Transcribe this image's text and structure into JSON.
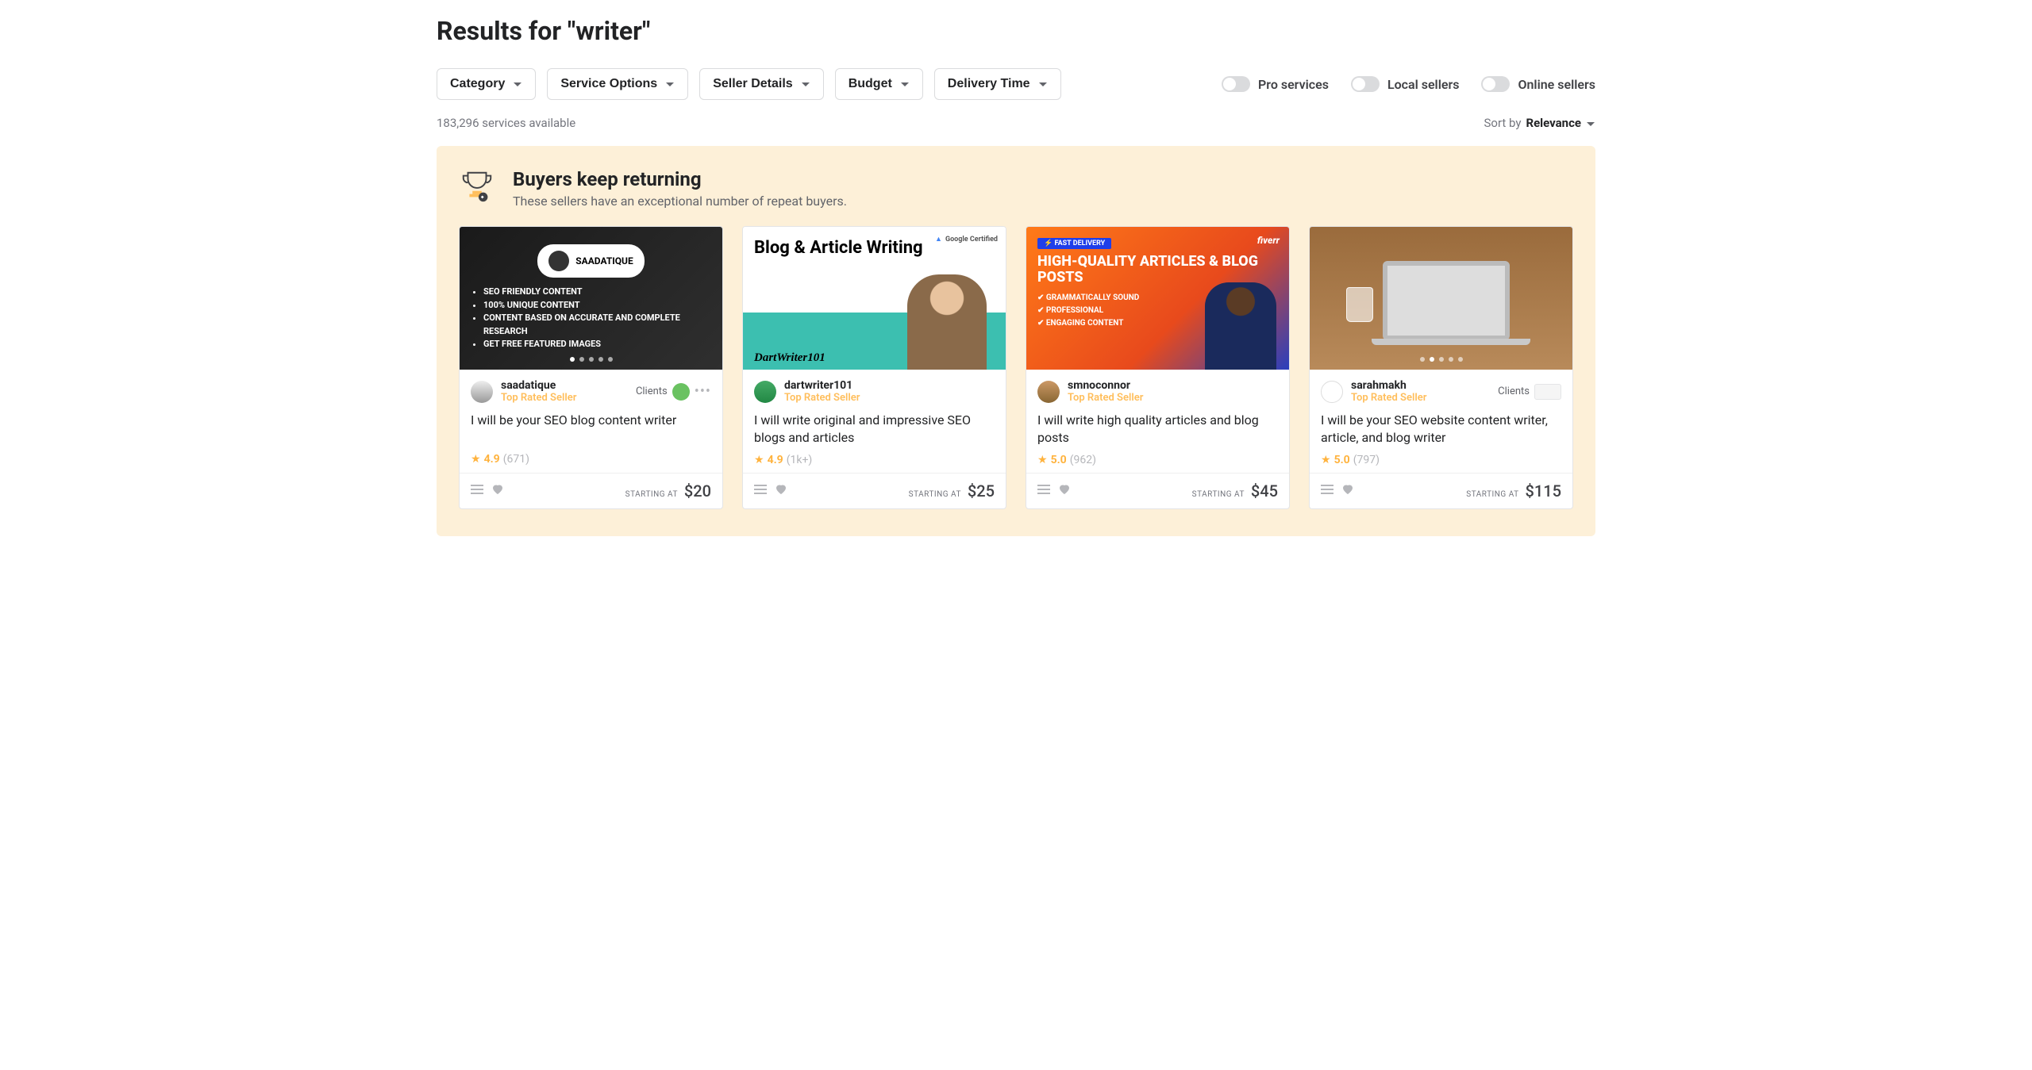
{
  "page_title": "Results for \"writer\"",
  "filters": [
    {
      "label": "Category"
    },
    {
      "label": "Service Options"
    },
    {
      "label": "Seller Details"
    },
    {
      "label": "Budget"
    },
    {
      "label": "Delivery Time"
    }
  ],
  "toggles": [
    {
      "label": "Pro services"
    },
    {
      "label": "Local sellers"
    },
    {
      "label": "Online sellers"
    }
  ],
  "results_count": "183,296 services available",
  "sort": {
    "label": "Sort by",
    "value": "Relevance"
  },
  "featured": {
    "heading": "Buyers keep returning",
    "subheading": "These sellers have an exceptional number of repeat buyers."
  },
  "gigs": [
    {
      "seller": "saadatique",
      "badge": "Top Rated Seller",
      "clients_label": "Clients",
      "has_clients": true,
      "title": "I will be your SEO blog content writer",
      "rating": "4.9",
      "rating_count": "(671)",
      "starting_label": "STARTING AT",
      "price": "$20",
      "thumb_brand": "SAADATIQUE",
      "thumb_bullets": [
        "SEO FRIENDLY CONTENT",
        "100% UNIQUE CONTENT",
        "CONTENT BASED ON ACCURATE AND COMPLETE RESEARCH",
        "GET FREE FEATURED IMAGES"
      ]
    },
    {
      "seller": "dartwriter101",
      "badge": "Top Rated Seller",
      "title": "I will write original and impressive SEO blogs and articles",
      "rating": "4.9",
      "rating_count": "(1k+)",
      "starting_label": "STARTING AT",
      "price": "$25",
      "thumb_title": "Blog & Article Writing",
      "thumb_script": "DartWriter101",
      "thumb_badge": "Google Certified"
    },
    {
      "seller": "smnoconnor",
      "badge": "Top Rated Seller",
      "title": "I will write high quality articles and blog posts",
      "rating": "5.0",
      "rating_count": "(962)",
      "starting_label": "STARTING AT",
      "price": "$45",
      "thumb_fast": "⚡ FAST DELIVERY",
      "thumb_headline": "HIGH-QUALITY ARTICLES & BLOG POSTS",
      "thumb_checks": [
        "GRAMMATICALLY SOUND",
        "PROFESSIONAL",
        "ENGAGING CONTENT"
      ],
      "thumb_fiverr": "fiverr"
    },
    {
      "seller": "sarahmakh",
      "badge": "Top Rated Seller",
      "clients_label": "Clients",
      "has_clients": true,
      "title": "I will be your SEO website content writer, article, and blog writer",
      "rating": "5.0",
      "rating_count": "(797)",
      "starting_label": "STARTING AT",
      "price": "$115"
    }
  ]
}
